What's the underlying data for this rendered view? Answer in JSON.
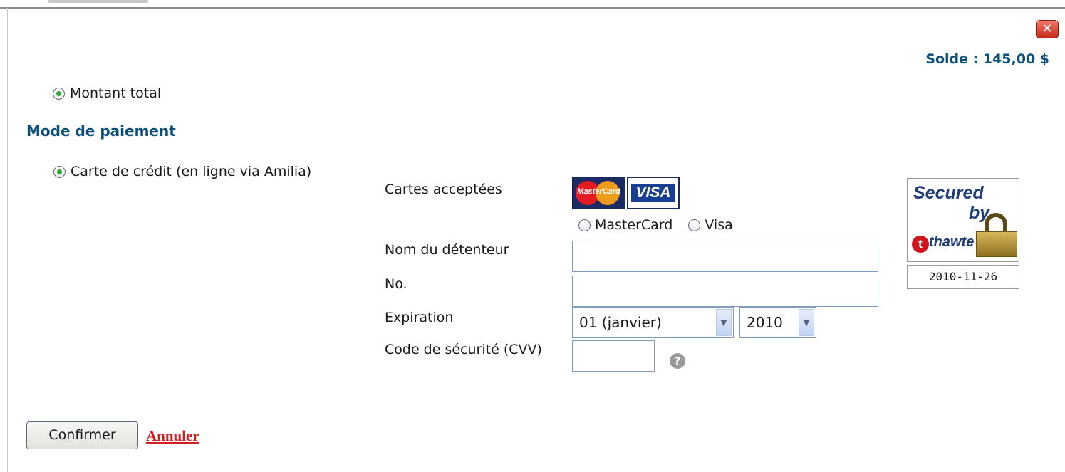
{
  "balance": {
    "text": "Solde : 145,00 $"
  },
  "amount_option": {
    "label": "Montant total",
    "selected": true
  },
  "payment": {
    "title": "Mode de paiement",
    "method_label": "Carte de crédit (en ligne via Amilia)",
    "method_selected": true
  },
  "cards": {
    "accepted_label": "Cartes acceptées",
    "mastercard_logo_text": "MasterCard",
    "visa_logo_text": "VISA",
    "brand_options": [
      "MasterCard",
      "Visa"
    ]
  },
  "form": {
    "holder_label": "Nom du détenteur",
    "holder_value": "",
    "number_label": "No.",
    "number_value": "",
    "expiration_label": "Expiration",
    "month_value": "01 (janvier)",
    "year_value": "2010",
    "cvv_label": "Code de sécurité (CVV)",
    "cvv_value": ""
  },
  "seal": {
    "line1": "Secured",
    "line2": "by",
    "brand": "thawte",
    "brand_icon": "t",
    "date": "2010-11-26"
  },
  "actions": {
    "confirm": "Confirmer",
    "cancel": "Annuler"
  },
  "icons": {
    "close": "close-icon",
    "help": "help-icon"
  },
  "colors": {
    "accent": "#0b4f7a",
    "cancel_link": "#d11f1f",
    "close_button": "#c8281c",
    "radio_dot": "#2fa334"
  }
}
